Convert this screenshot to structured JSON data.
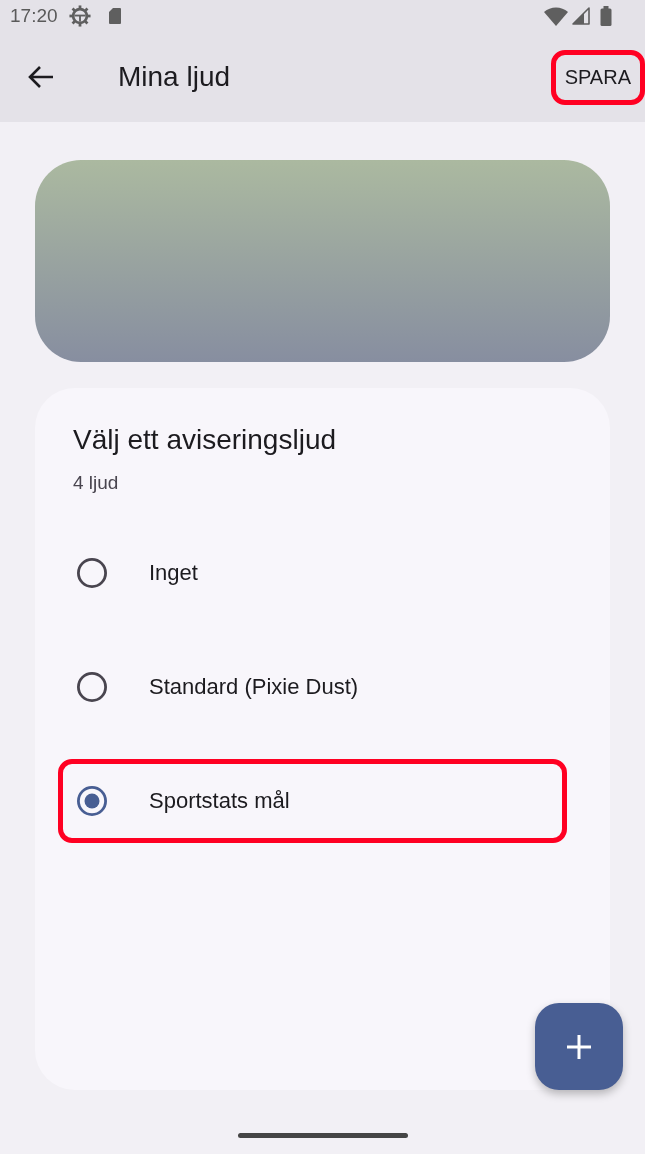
{
  "status_bar": {
    "time": "17:20"
  },
  "app_bar": {
    "title": "Mina ljud",
    "save_button": {
      "label": "SPARA",
      "highlighted": true
    }
  },
  "sound_picker": {
    "title": "Välj ett aviseringsljud",
    "count": "4 ljud",
    "options": [
      {
        "label": "Inget",
        "selected": false,
        "highlighted": false
      },
      {
        "label": "Standard (Pixie Dust)",
        "selected": false,
        "highlighted": false
      },
      {
        "label": "Sportstats mål",
        "selected": true,
        "highlighted": true
      }
    ]
  }
}
